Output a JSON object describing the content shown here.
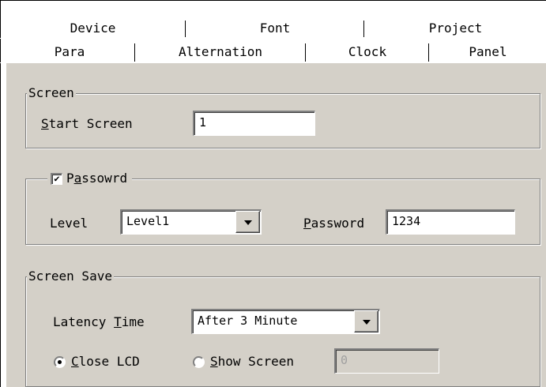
{
  "tabs_back": [
    "Device",
    "Font",
    "Project"
  ],
  "tabs_front": [
    "Para",
    "Alternation",
    "Clock",
    "Panel"
  ],
  "screen": {
    "legend": "Screen",
    "start_label": "Start Screen",
    "start_underline": "S",
    "start_rest": "tart Screen",
    "start_value": "1"
  },
  "password_group": {
    "checkbox_checked": true,
    "check_mark": "✔",
    "legend_pre": "P",
    "legend_u": "a",
    "legend_post": "ssowrd",
    "level_label": "Level",
    "level_value": "Level1",
    "password_u": "P",
    "password_rest": "assword",
    "password_value": "1234"
  },
  "screen_save": {
    "legend": "Screen Save",
    "latency_pre": "Latency ",
    "latency_u": "T",
    "latency_post": "ime",
    "latency_value": "After 3 Minute",
    "close_u": "C",
    "close_rest": "lose LCD",
    "close_selected": true,
    "show_u": "S",
    "show_rest": "how Screen",
    "show_selected": false,
    "show_value": "0"
  }
}
